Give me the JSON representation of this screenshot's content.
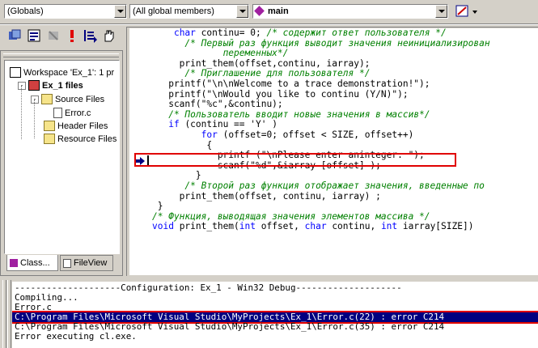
{
  "toolbar": {
    "scope_combo": "(Globals)",
    "members_combo": "(All global members)",
    "function_combo": "main"
  },
  "workspace": {
    "items": [
      {
        "label": "Workspace 'Ex_1': 1 pr"
      },
      {
        "label": "Ex_1 files"
      },
      {
        "label": "Source Files"
      },
      {
        "label": "Error.c"
      },
      {
        "label": "Header Files"
      },
      {
        "label": "Resource Files"
      }
    ],
    "tabs": [
      {
        "label": "Class..."
      },
      {
        "label": "FileView"
      }
    ]
  },
  "editor": {
    "lines": [
      [
        {
          "t": "    "
        },
        {
          "t": "char",
          "c": "kw"
        },
        {
          "t": " continu= 0; "
        },
        {
          "t": "/* содержит ответ пользователя */",
          "c": "cm"
        }
      ],
      [
        {
          "t": "      "
        },
        {
          "t": "/* Первый раз функция выводит значения неинициализирован",
          "c": "cm"
        }
      ],
      [
        {
          "t": "             "
        },
        {
          "t": "переменных*/",
          "c": "cm"
        }
      ],
      [
        {
          "t": "     print_them(offset,continu, iarray);"
        }
      ],
      [
        {
          "t": "      "
        },
        {
          "t": "/* Приглашение для пользователя */",
          "c": "cm"
        }
      ],
      [
        {
          "t": "   printf(\"\\n\\nWelcome to a trace demonstration!\");"
        }
      ],
      [
        {
          "t": "   printf(\"\\nWould you like to continu (Y/N)\");"
        }
      ],
      [
        {
          "t": "   scanf(\"%c\",&continu);"
        }
      ],
      [
        {
          "t": "   "
        },
        {
          "t": "/* Пользователь вводит новые значения в массив*/",
          "c": "cm"
        }
      ],
      [
        {
          "t": "   "
        },
        {
          "t": "if",
          "c": "kw"
        },
        {
          "t": " (continu == 'Y' )"
        }
      ],
      [
        {
          "t": "         "
        },
        {
          "t": "for",
          "c": "kw"
        },
        {
          "t": " (offset=0; offset < SIZE, offset++)"
        }
      ],
      [
        {
          "t": "          {"
        }
      ],
      [
        {
          "t": "            printf (\"\\nPlease enter aninteger: \");"
        }
      ],
      [
        {
          "t": "            scanf(\"%d\",&iarray [offset] );"
        }
      ],
      [
        {
          "t": "        }"
        }
      ],
      [
        {
          "t": "      "
        },
        {
          "t": "/* Второй раз функция отображает значения, введенные по",
          "c": "cm"
        }
      ],
      [
        {
          "t": "     print_them(offset, continu, iarray) ;"
        }
      ],
      [
        {
          "t": " }"
        }
      ],
      [
        {
          "t": ""
        },
        {
          "t": "/* Функция, выводящая значения элементов массива */",
          "c": "cm"
        }
      ],
      [
        {
          "t": ""
        },
        {
          "t": "void",
          "c": "kw"
        },
        {
          "t": " print_them("
        },
        {
          "t": "int",
          "c": "kw"
        },
        {
          "t": " offset, "
        },
        {
          "t": "char",
          "c": "kw"
        },
        {
          "t": " continu, "
        },
        {
          "t": "int",
          "c": "kw"
        },
        {
          "t": " iarray[SIZE])"
        }
      ]
    ]
  },
  "output": {
    "lines": [
      "--------------------Configuration: Ex_1 - Win32 Debug--------------------",
      "Compiling...",
      "Error.c",
      "C:\\Program Files\\Microsoft Visual Studio\\MyProjects\\Ex_1\\Error.c(22) : error C214",
      "C:\\Program Files\\Microsoft Visual Studio\\MyProjects\\Ex_1\\Error.c(35) : error C214",
      "Error executing cl.exe."
    ],
    "selected_line": 3
  },
  "colors": {
    "highlight_box": "#e00000",
    "selection_bg": "#000080",
    "keyword": "#0000ff",
    "comment": "#008000"
  }
}
